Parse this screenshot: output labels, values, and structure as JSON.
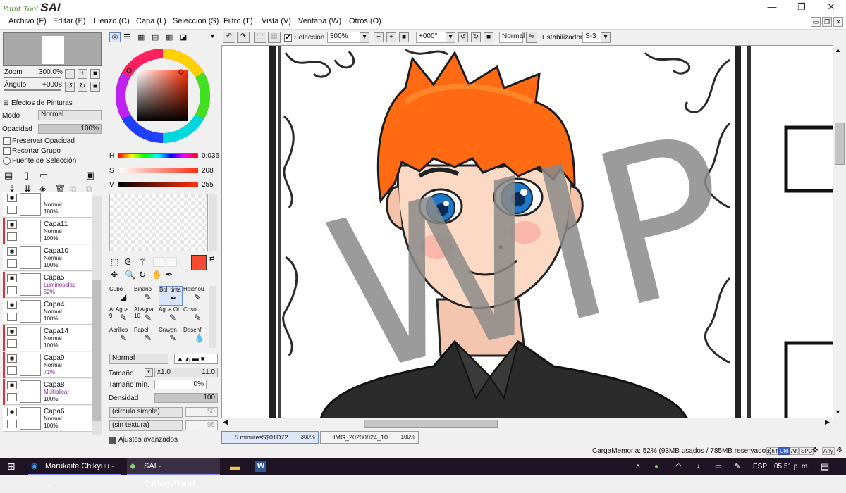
{
  "app": {
    "logo_small": "Paint Tool",
    "logo_big": "SAI"
  },
  "window": {
    "minimize": "—",
    "maximize": "❐",
    "close": "✕"
  },
  "menu": [
    "Archivo (F)",
    "Editar (E)",
    "Lienzo (C)",
    "Capa (L)",
    "Selección (S)",
    "Filtro (T)",
    "Vista (V)",
    "Ventana (W)",
    "Otros (O)"
  ],
  "navigator": {
    "zoom_label": "Zoom",
    "zoom_value": "300.0%",
    "angle_label": "Ángulo",
    "angle_value": "+0008"
  },
  "paint_effects": {
    "header": "Efectos de Pinturas",
    "mode_label": "Modo",
    "mode_value": "Normal",
    "opacity_label": "Opacidad",
    "opacity_value": "100%",
    "opacity_fraction": 1.0
  },
  "layer_options": {
    "preserve": "Preservar Opacidad",
    "clip": "Recortar Grupo",
    "selection_source": "Fuente de Selección"
  },
  "layers": [
    {
      "name": "",
      "mode": "Normal",
      "opacity": "100%",
      "marked": false
    },
    {
      "name": "Capa11",
      "mode": "Normal",
      "opacity": "100%",
      "marked": true
    },
    {
      "name": "Capa10",
      "mode": "Normal",
      "opacity": "100%",
      "marked": false
    },
    {
      "name": "Capa5",
      "mode": "Luminosidad",
      "opacity": "52%",
      "marked": true
    },
    {
      "name": "Capa4",
      "mode": "Normal",
      "opacity": "100%",
      "marked": false
    },
    {
      "name": "Capa14",
      "mode": "Normal",
      "opacity": "100%",
      "marked": true
    },
    {
      "name": "Capa9",
      "mode": "Normal",
      "opacity": "71%",
      "marked": true
    },
    {
      "name": "Capa8",
      "mode": "Multiplicar",
      "opacity": "100%",
      "marked": true
    },
    {
      "name": "Capa6",
      "mode": "Normal",
      "opacity": "100%",
      "marked": false
    }
  ],
  "color": {
    "h_label": "H",
    "h_value": "0:036",
    "s_label": "S",
    "s_value": "208",
    "v_label": "V",
    "v_value": "255",
    "foreground": "#f34a30"
  },
  "tools": [
    {
      "label": "Cubo",
      "icon": "bucket-icon",
      "glyph": "◢"
    },
    {
      "label": "Binario",
      "icon": "pencil-icon",
      "glyph": "✎"
    },
    {
      "label": "Boli tinta",
      "icon": "pen-icon",
      "glyph": "✒"
    },
    {
      "label": "Heichou",
      "icon": "pen-icon",
      "glyph": "✎"
    },
    {
      "label": "Al Agua 9",
      "icon": "brush-icon",
      "glyph": "✎"
    },
    {
      "label": "Al Agua 10",
      "icon": "brush-icon",
      "glyph": "✎"
    },
    {
      "label": "Agua Ol",
      "icon": "brush-icon",
      "glyph": "✎"
    },
    {
      "label": "Coso",
      "icon": "brush-icon",
      "glyph": "✎"
    },
    {
      "label": "Acrílico",
      "icon": "brush-icon",
      "glyph": "✎"
    },
    {
      "label": "Papel",
      "icon": "brush-icon",
      "glyph": "✎"
    },
    {
      "label": "Crayon",
      "icon": "crayon-icon",
      "glyph": "✎"
    },
    {
      "label": "Desenf.",
      "icon": "blur-icon",
      "glyph": "💧"
    }
  ],
  "brush": {
    "mode_value": "Normal",
    "size_label": "Tamaño",
    "size_multiplier": "x1.0",
    "size_value": "11.0",
    "min_size_label": "Tamaño mín.",
    "min_size_value": "0%",
    "density_label": "Densidad",
    "density_value": "100",
    "shape_value": "(círculo simple)",
    "shape_num": "50",
    "texture_value": "(sin textura)",
    "texture_num": "95",
    "advanced_label": "Ajustes avanzados"
  },
  "canvas_toolbar": {
    "selection_label": "Selección",
    "zoom_value": "300%",
    "rotation_value": "+000°",
    "mode_value": "Normal",
    "stabilizer_label": "Estabilizador",
    "stabilizer_value": "S-3"
  },
  "artwork": {
    "watermark": "WIP"
  },
  "tabs": [
    {
      "title": "5 minutes$$01D72...",
      "zoom": "300%"
    },
    {
      "title": "IMG_20200824_10...",
      "zoom": "100%"
    }
  ],
  "status": {
    "memory": "CargaMemoria: 52% (93MB usados / 785MB reservados)",
    "keys": [
      "Shift",
      "Ctrl",
      "Alt",
      "SPC",
      "Any"
    ]
  },
  "taskbar": {
    "apps": [
      "Marukaite Chikyuu - ...",
      "SAI - C:\\Users\\Yamil..."
    ],
    "lang": "ESP",
    "time": "05:51 p. m."
  }
}
